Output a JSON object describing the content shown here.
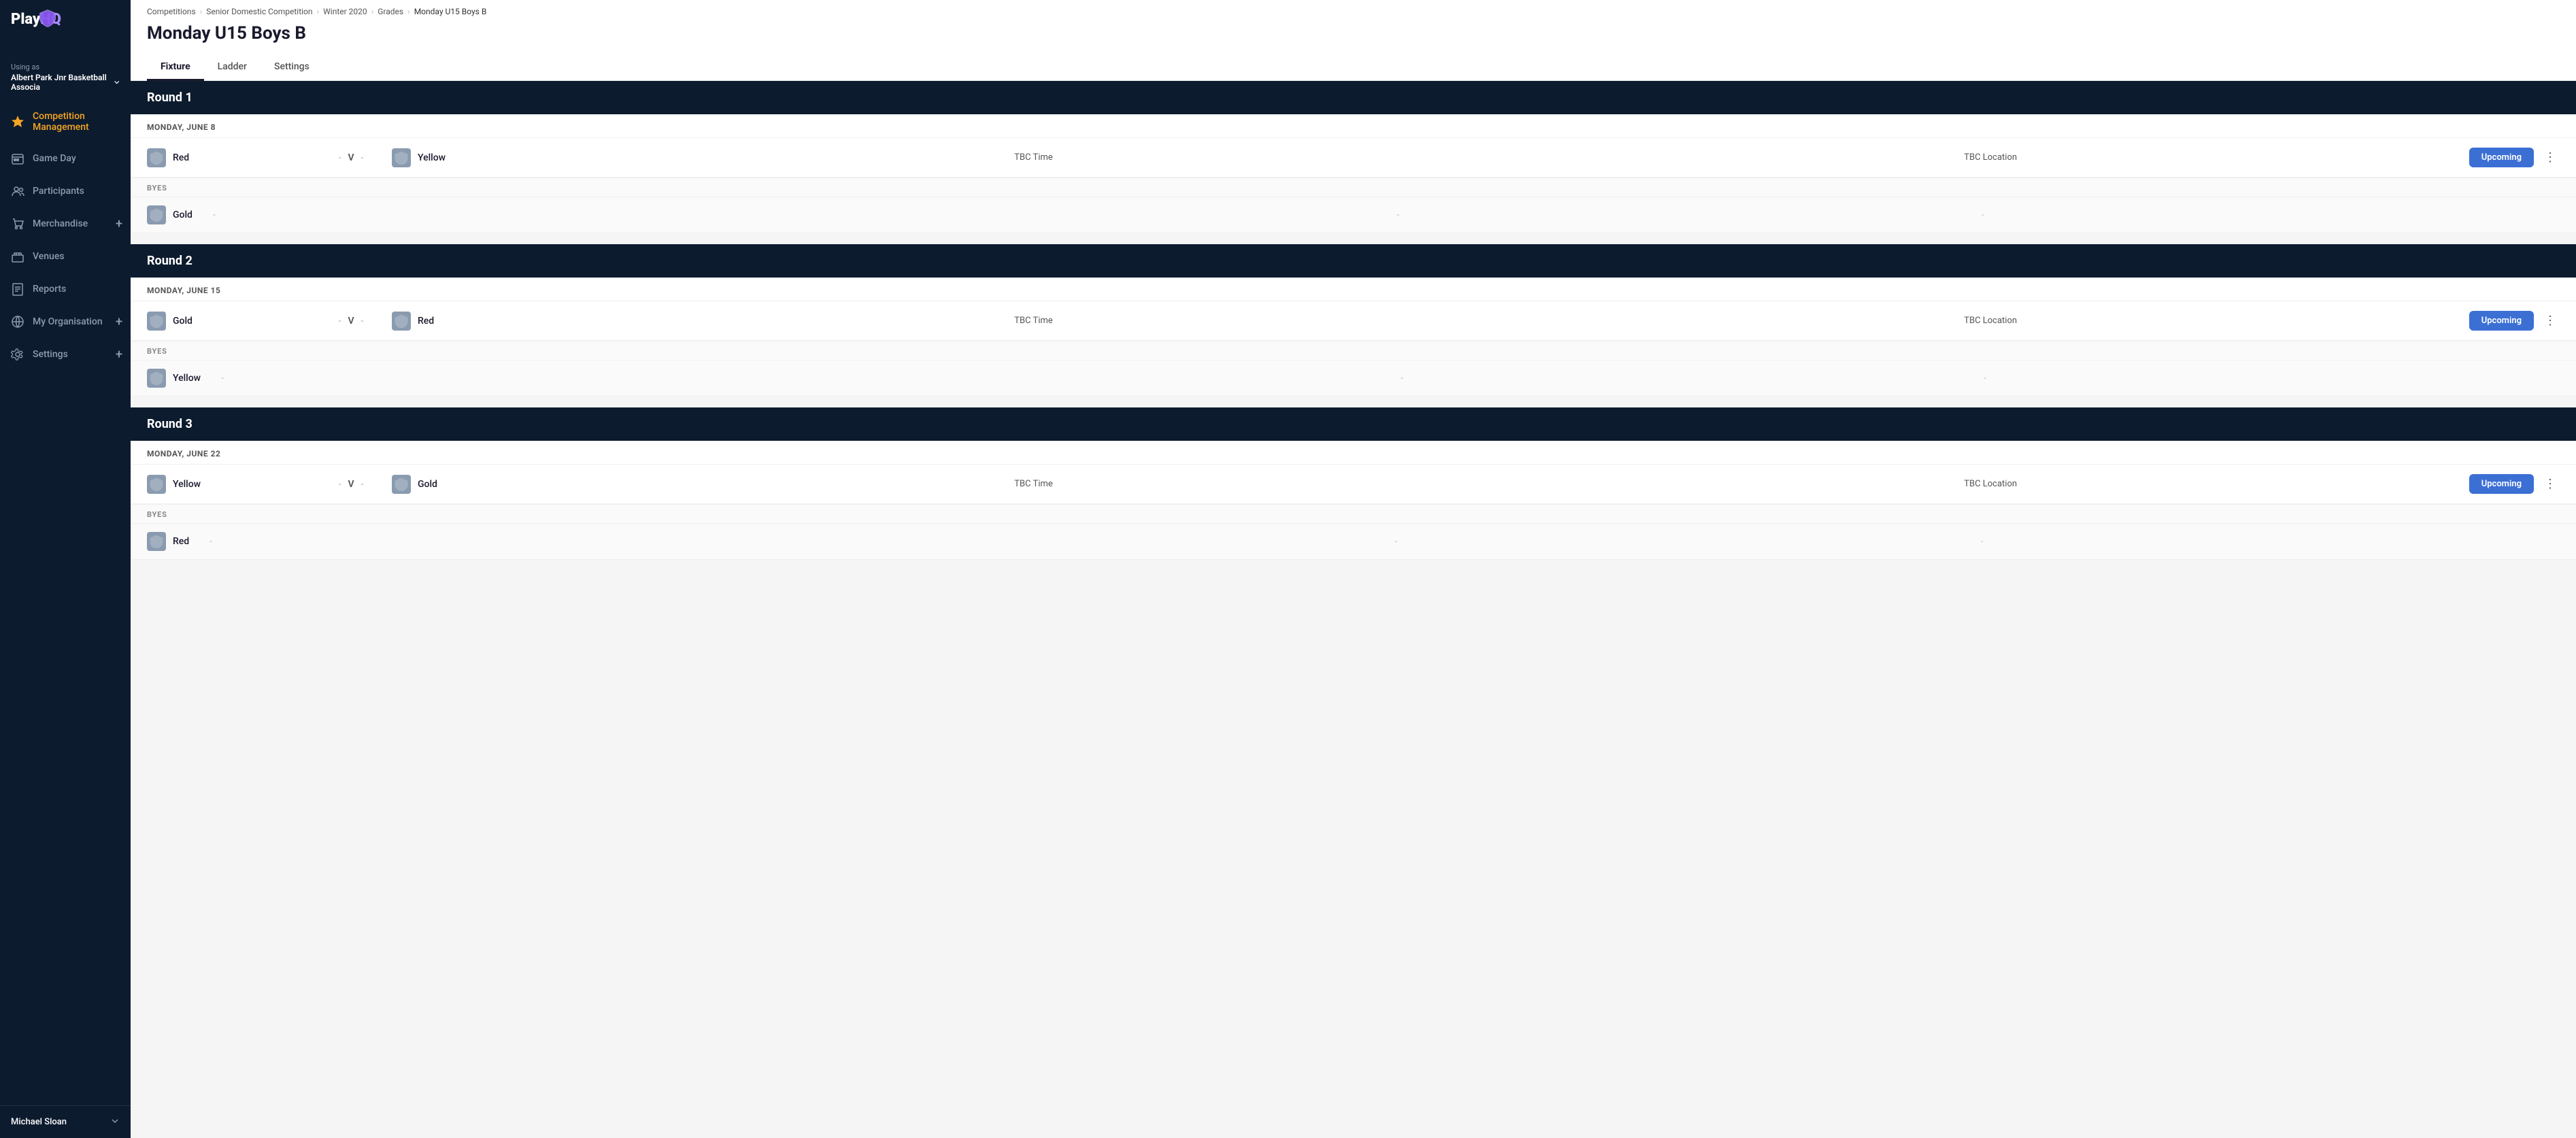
{
  "sidebar": {
    "logo_text": "PlayHQ",
    "using_label": "Using as",
    "org_name": "Albert Park Jnr Basketball Associa",
    "nav_items": [
      {
        "id": "competition-management",
        "label": "Competition Management",
        "icon": "trophy",
        "active": true,
        "plus": false
      },
      {
        "id": "game-day",
        "label": "Game Day",
        "icon": "gameday",
        "active": false,
        "plus": false
      },
      {
        "id": "participants",
        "label": "Participants",
        "icon": "participants",
        "active": false,
        "plus": false
      },
      {
        "id": "merchandise",
        "label": "Merchandise",
        "icon": "merchandise",
        "active": false,
        "plus": true
      },
      {
        "id": "venues",
        "label": "Venues",
        "icon": "venues",
        "active": false,
        "plus": false
      },
      {
        "id": "reports",
        "label": "Reports",
        "icon": "reports",
        "active": false,
        "plus": false
      },
      {
        "id": "my-organisation",
        "label": "My Organisation",
        "icon": "org",
        "active": false,
        "plus": true
      },
      {
        "id": "settings",
        "label": "Settings",
        "icon": "settings",
        "active": false,
        "plus": true
      }
    ],
    "footer_name": "Michael Sloan"
  },
  "breadcrumb": {
    "items": [
      {
        "label": "Competitions",
        "link": true
      },
      {
        "label": "Senior Domestic Competition",
        "link": true
      },
      {
        "label": "Winter 2020",
        "link": true
      },
      {
        "label": "Grades",
        "link": true
      },
      {
        "label": "Monday U15 Boys B",
        "link": false
      }
    ]
  },
  "page": {
    "title": "Monday U15 Boys B",
    "tabs": [
      {
        "id": "fixture",
        "label": "Fixture",
        "active": true
      },
      {
        "id": "ladder",
        "label": "Ladder",
        "active": false
      },
      {
        "id": "settings",
        "label": "Settings",
        "active": false
      }
    ]
  },
  "rounds": [
    {
      "id": "round1",
      "label": "Round 1",
      "date": "MONDAY, JUNE 8",
      "fixtures": [
        {
          "home_team": "Red",
          "away_team": "Yellow",
          "home_score": "-",
          "away_score": "-",
          "time": "TBC Time",
          "location": "TBC Location",
          "status": "Upcoming",
          "has_menu": true
        }
      ],
      "byes": [
        "Gold"
      ]
    },
    {
      "id": "round2",
      "label": "Round 2",
      "date": "MONDAY, JUNE 15",
      "fixtures": [
        {
          "home_team": "Gold",
          "away_team": "Red",
          "home_score": "-",
          "away_score": "-",
          "time": "TBC Time",
          "location": "TBC Location",
          "status": "Upcoming",
          "has_menu": true
        }
      ],
      "byes": [
        "Yellow"
      ]
    },
    {
      "id": "round3",
      "label": "Round 3",
      "date": "MONDAY, JUNE 22",
      "fixtures": [
        {
          "home_team": "Yellow",
          "away_team": "Gold",
          "home_score": "-",
          "away_score": "-",
          "time": "TBC Time",
          "location": "TBC Location",
          "status": "Upcoming",
          "has_menu": true
        }
      ],
      "byes": [
        "Red"
      ]
    }
  ],
  "labels": {
    "byes": "BYES",
    "v": "V",
    "using_as": "Using as"
  },
  "colors": {
    "sidebar_bg": "#0d1b2e",
    "active_nav": "#f5a623",
    "status_badge": "#3b6fd4",
    "round_header": "#0d1b2e"
  }
}
